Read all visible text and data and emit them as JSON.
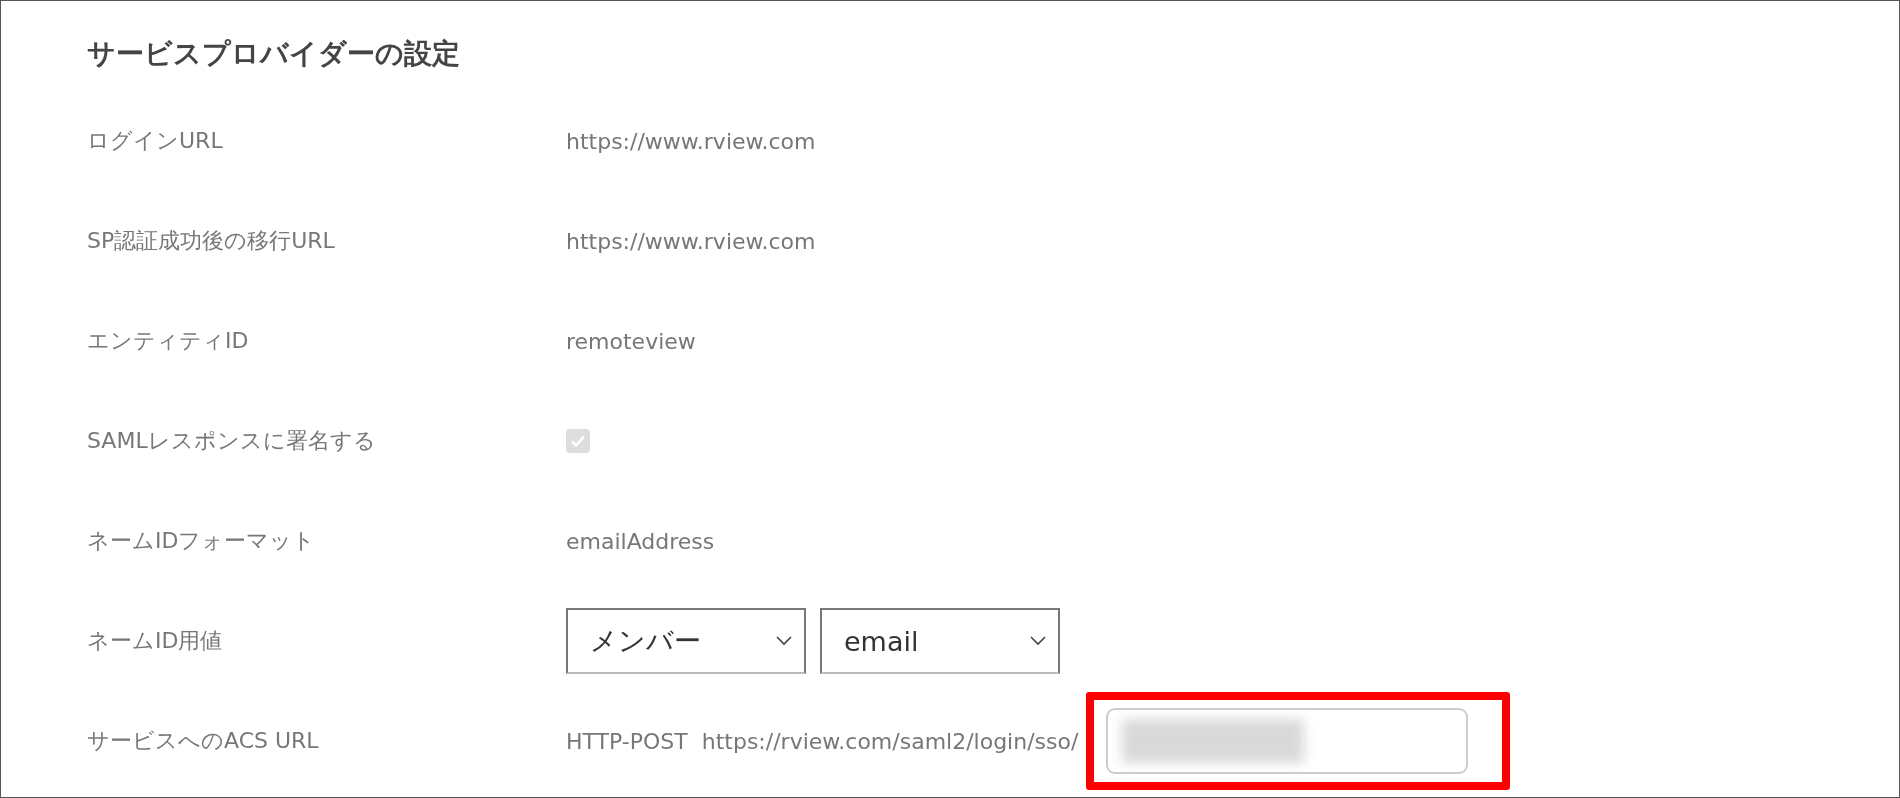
{
  "heading": "サービスプロバイダーの設定",
  "rows": [
    {
      "kind": "text",
      "label": "ログインURL",
      "value": "https://www.rview.com"
    },
    {
      "kind": "text",
      "label": "SP認証成功後の移行URL",
      "value": "https://www.rview.com"
    },
    {
      "kind": "text",
      "label": "エンティティID",
      "value": "remoteview"
    },
    {
      "kind": "checkbox",
      "label": "SAMLレスポンスに署名する",
      "checked": true,
      "disabled": true
    },
    {
      "kind": "text",
      "label": "ネームIDフォーマット",
      "value": "emailAddress"
    },
    {
      "kind": "selects",
      "label": "ネームID用値",
      "selects": [
        "メンバー",
        "email"
      ]
    },
    {
      "kind": "acs",
      "label": "サービスへのACS URL",
      "binding": "HTTP-POST",
      "prefix": "https://rview.com/saml2/login/sso/",
      "highlighted": true
    }
  ]
}
